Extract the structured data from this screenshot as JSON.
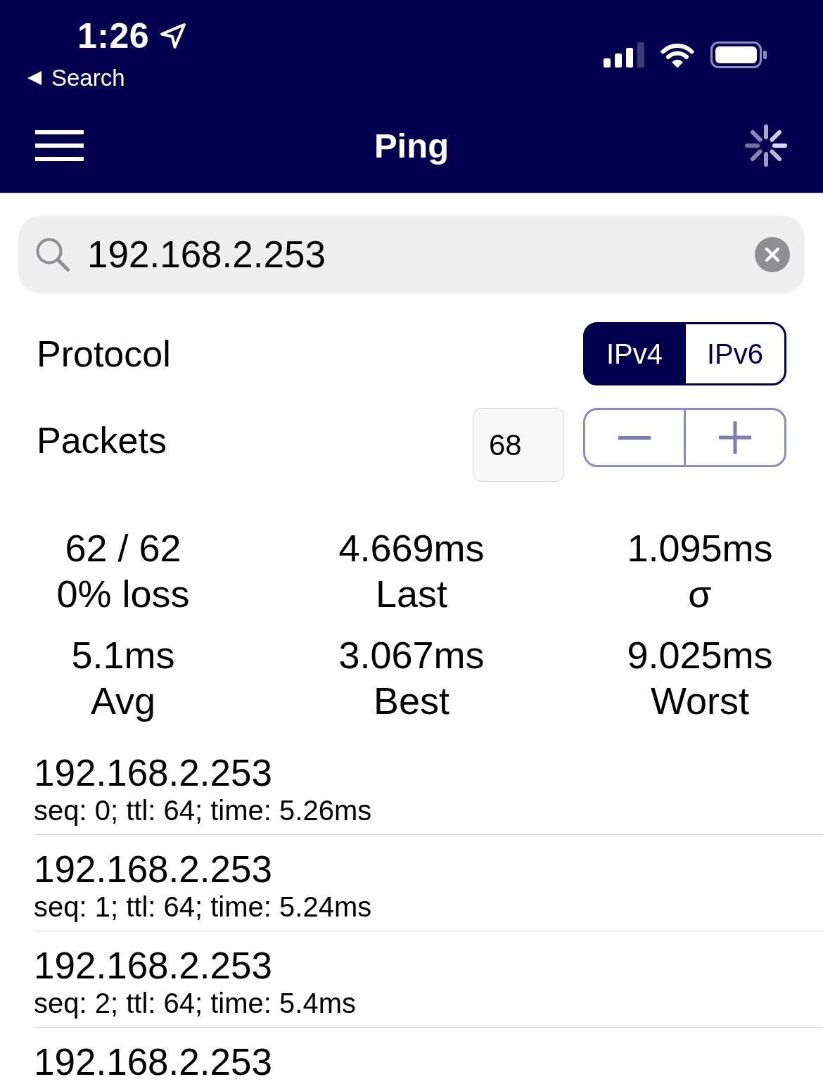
{
  "status_bar": {
    "time": "1:26",
    "back_label": "Search"
  },
  "nav_bar": {
    "title": "Ping",
    "loading": true
  },
  "search": {
    "value": "192.168.2.253"
  },
  "settings": [
    {
      "kind": "segmented",
      "label": "Protocol",
      "options": [
        {
          "label": "IPv4",
          "selected": true
        },
        {
          "label": "IPv6",
          "selected": false
        }
      ]
    },
    {
      "kind": "stepper",
      "label": "Packets",
      "value": "68"
    }
  ],
  "stats": [
    {
      "value": "62 / 62",
      "label": "0% loss"
    },
    {
      "value": "4.669ms",
      "label": "Last"
    },
    {
      "value": "1.095ms",
      "label": "σ"
    },
    {
      "value": "5.1ms",
      "label": "Avg"
    },
    {
      "value": "3.067ms",
      "label": "Best"
    },
    {
      "value": "9.025ms",
      "label": "Worst"
    }
  ],
  "results": [
    {
      "host": "192.168.2.253",
      "detail": "seq: 0; ttl: 64; time: 5.26ms"
    },
    {
      "host": "192.168.2.253",
      "detail": "seq: 1; ttl: 64; time: 5.24ms"
    },
    {
      "host": "192.168.2.253",
      "detail": "seq: 2; ttl: 64; time: 5.4ms"
    },
    {
      "host": "192.168.2.253"
    }
  ]
}
